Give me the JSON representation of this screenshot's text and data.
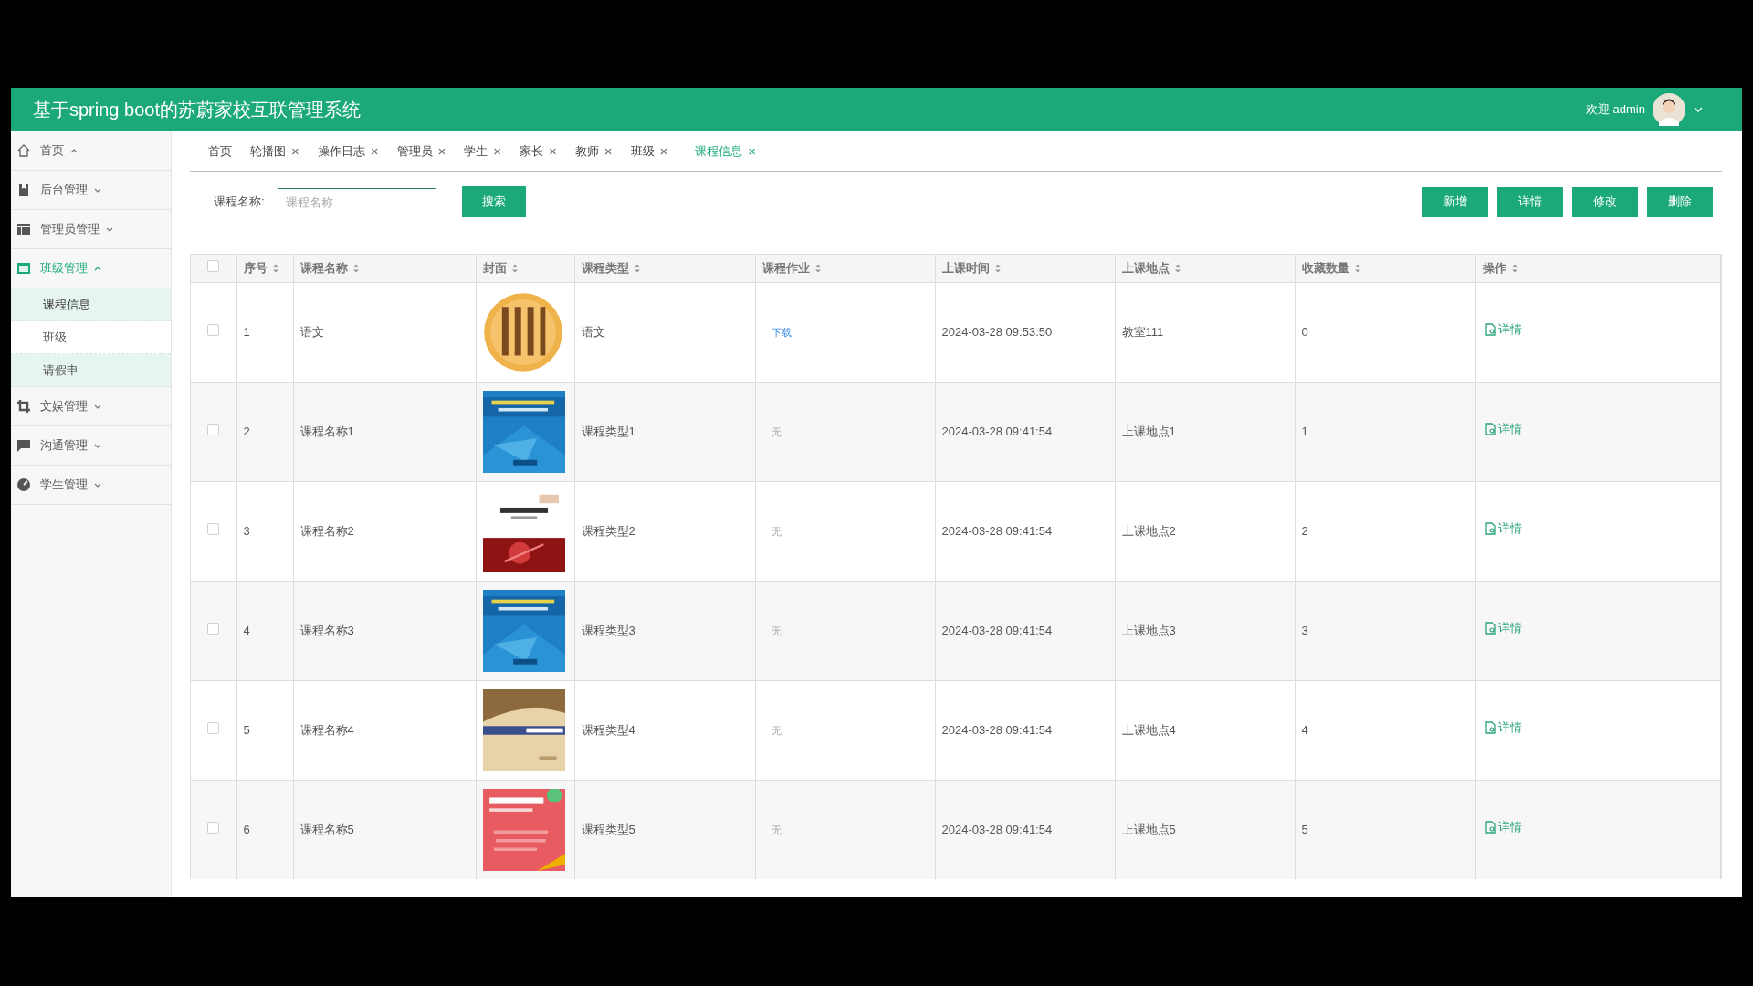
{
  "header": {
    "title": "基于spring boot的苏蔚家校互联管理系统",
    "welcome": "欢迎 admin"
  },
  "sidebar": {
    "items": [
      {
        "label": "首页",
        "expanded": true,
        "selected": false
      },
      {
        "label": "后台管理",
        "expanded": false,
        "selected": false
      },
      {
        "label": "管理员管理",
        "expanded": false,
        "selected": false
      },
      {
        "label": "班级管理",
        "expanded": true,
        "selected": true,
        "children": [
          {
            "label": "课程信息",
            "selected": true,
            "hovered": false
          },
          {
            "label": "班级",
            "selected": false,
            "hovered": false
          },
          {
            "label": "请假申",
            "selected": false,
            "hovered": true
          }
        ]
      },
      {
        "label": "文娱管理",
        "expanded": false,
        "selected": false
      },
      {
        "label": "沟通管理",
        "expanded": false,
        "selected": false
      },
      {
        "label": "学生管理",
        "expanded": false,
        "selected": false
      }
    ]
  },
  "tabs": [
    {
      "label": "首页",
      "closable": false,
      "selected": false
    },
    {
      "label": "轮播图",
      "closable": true,
      "selected": false
    },
    {
      "label": "操作日志",
      "closable": true,
      "selected": false
    },
    {
      "label": "管理员",
      "closable": true,
      "selected": false
    },
    {
      "label": "学生",
      "closable": true,
      "selected": false
    },
    {
      "label": "家长",
      "closable": true,
      "selected": false
    },
    {
      "label": "教师",
      "closable": true,
      "selected": false
    },
    {
      "label": "班级",
      "closable": true,
      "selected": false
    },
    {
      "label": "课程信息",
      "closable": true,
      "selected": true
    }
  ],
  "close_glyph": "×",
  "search": {
    "label": "课程名称:",
    "placeholder": "课程名称",
    "button": "搜索"
  },
  "actions": [
    "新增",
    "详情",
    "修改",
    "删除"
  ],
  "table": {
    "header_checked": false,
    "columns": [
      "序号",
      "课程名称",
      "封面",
      "课程类型",
      "课程作业",
      "上课时间",
      "上课地点",
      "收藏数量",
      "操作"
    ],
    "rows": [
      {
        "checked": false,
        "no": "1",
        "name": "语文",
        "type": "语文",
        "homework": {
          "kind": "link",
          "text": "下载"
        },
        "time": "2024-03-28 09:53:50",
        "place": "教室111",
        "favorites": "0",
        "action": "详情"
      },
      {
        "checked": false,
        "no": "2",
        "name": "课程名称1",
        "type": "课程类型1",
        "homework": {
          "kind": "none",
          "text": "无"
        },
        "time": "2024-03-28 09:41:54",
        "place": "上课地点1",
        "favorites": "1",
        "action": "详情"
      },
      {
        "checked": false,
        "no": "3",
        "name": "课程名称2",
        "type": "课程类型2",
        "homework": {
          "kind": "none",
          "text": "无"
        },
        "time": "2024-03-28 09:41:54",
        "place": "上课地点2",
        "favorites": "2",
        "action": "详情"
      },
      {
        "checked": false,
        "no": "4",
        "name": "课程名称3",
        "type": "课程类型3",
        "homework": {
          "kind": "none",
          "text": "无"
        },
        "time": "2024-03-28 09:41:54",
        "place": "上课地点3",
        "favorites": "3",
        "action": "详情"
      },
      {
        "checked": false,
        "no": "5",
        "name": "课程名称4",
        "type": "课程类型4",
        "homework": {
          "kind": "none",
          "text": "无"
        },
        "time": "2024-03-28 09:41:54",
        "place": "上课地点4",
        "favorites": "4",
        "action": "详情"
      },
      {
        "checked": false,
        "no": "6",
        "name": "课程名称5",
        "type": "课程类型5",
        "homework": {
          "kind": "none",
          "text": "无"
        },
        "time": "2024-03-28 09:41:54",
        "place": "上课地点5",
        "favorites": "5",
        "action": "详情"
      }
    ]
  }
}
